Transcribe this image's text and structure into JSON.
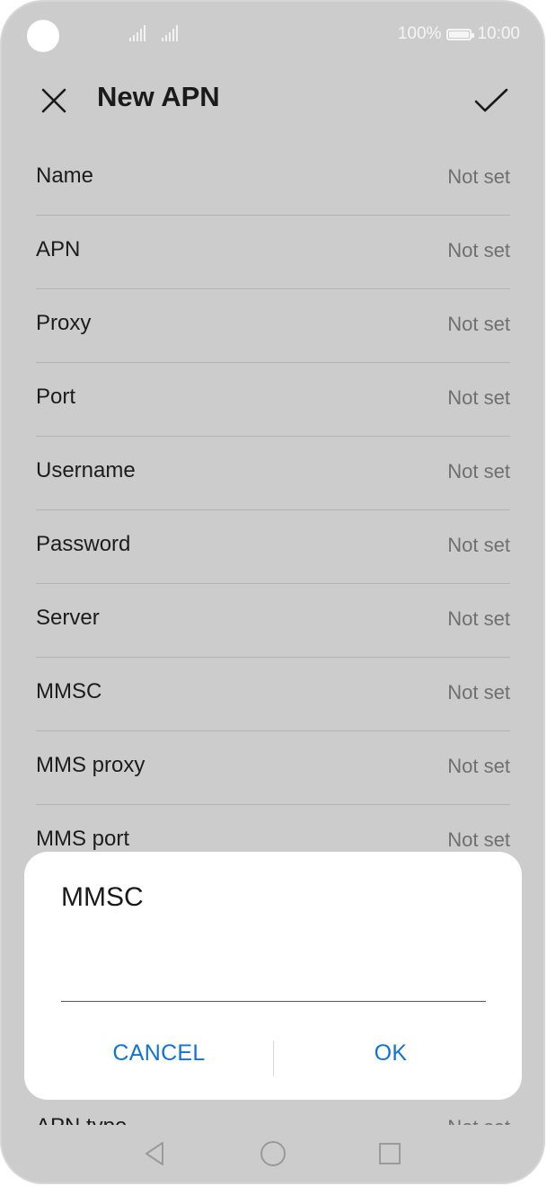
{
  "status_bar": {
    "battery_percent": "100%",
    "time": "10:00"
  },
  "header": {
    "title": "New APN"
  },
  "fields": [
    {
      "label": "Name",
      "value": "Not set"
    },
    {
      "label": "APN",
      "value": "Not set"
    },
    {
      "label": "Proxy",
      "value": "Not set"
    },
    {
      "label": "Port",
      "value": "Not set"
    },
    {
      "label": "Username",
      "value": "Not set"
    },
    {
      "label": "Password",
      "value": "Not set"
    },
    {
      "label": "Server",
      "value": "Not set"
    },
    {
      "label": "MMSC",
      "value": "Not set"
    },
    {
      "label": "MMS proxy",
      "value": "Not set"
    },
    {
      "label": "MMS port",
      "value": "Not set"
    }
  ],
  "peek_row": {
    "label": "APN type",
    "value": "Not set"
  },
  "dialog": {
    "title": "MMSC",
    "input_value": "",
    "cancel_label": "CANCEL",
    "ok_label": "OK"
  },
  "colors": {
    "background": "#cccccc",
    "accent": "#1273d6",
    "dialog": "#ffffff"
  },
  "icons": {
    "close": "close-icon",
    "confirm": "checkmark-icon",
    "back": "back-triangle-icon",
    "home": "home-circle-icon",
    "recents": "recents-square-icon"
  }
}
